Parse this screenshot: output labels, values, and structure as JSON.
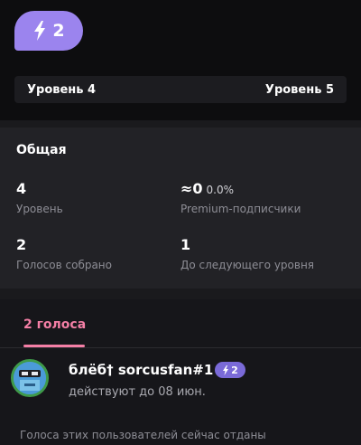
{
  "boost": {
    "count": "2"
  },
  "levels": {
    "current": "Уровень 4",
    "next": "Уровень 5"
  },
  "stats": {
    "title": "Общая",
    "level_value": "4",
    "level_label": "Уровень",
    "premium_value": "≈0",
    "premium_percent": "0.0%",
    "premium_label": "Premium-подписчики",
    "votes_value": "2",
    "votes_label": "Голосов собрано",
    "remaining_value": "1",
    "remaining_label": "До следующего уровня"
  },
  "tab": {
    "label": "2 голоса"
  },
  "member": {
    "name": "блёб† sorcusfan#1",
    "boost_count": "2",
    "subtitle": "действуют до 08 июн."
  },
  "footnote": "Голоса этих пользователей сейчас отданы",
  "colors": {
    "accent": "#9b84ee",
    "tab": "#f47fa6",
    "avatar_ring": "#3f9a4a"
  }
}
